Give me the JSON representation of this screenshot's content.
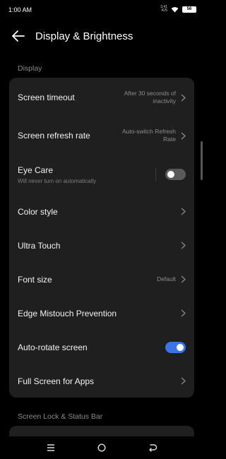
{
  "status_bar": {
    "time": "1:00 AM",
    "net_speed_value": "3.41",
    "net_speed_unit": "K/S",
    "battery": "56"
  },
  "header": {
    "title": "Display & Brightness"
  },
  "sections": {
    "display": "Display",
    "screen_lock": "Screen Lock & Status Bar"
  },
  "rows": {
    "screen_timeout": {
      "title": "Screen timeout",
      "value_line1": "After 30 seconds of",
      "value_line2": "inactivity"
    },
    "refresh_rate": {
      "title": "Screen refresh rate",
      "value_line1": "Auto-switch Refresh",
      "value_line2": "Rate"
    },
    "eye_care": {
      "title": "Eye Care",
      "subtitle": "Will never turn on automatically",
      "enabled": false
    },
    "color_style": {
      "title": "Color style"
    },
    "ultra_touch": {
      "title": "Ultra Touch"
    },
    "font_size": {
      "title": "Font size",
      "value": "Default"
    },
    "edge_mistouch": {
      "title": "Edge Mistouch Prevention"
    },
    "auto_rotate": {
      "title": "Auto-rotate screen",
      "enabled": true
    },
    "full_screen": {
      "title": "Full Screen for Apps"
    }
  },
  "colors": {
    "background": "#000000",
    "card": "#1f1f1f",
    "toggle_on": "#3a74e8",
    "toggle_off": "#5a5a5a",
    "secondary_text": "#8d8d8d"
  },
  "nav": {
    "icons": [
      "menu-icon",
      "home-icon",
      "back-nav-icon"
    ]
  }
}
